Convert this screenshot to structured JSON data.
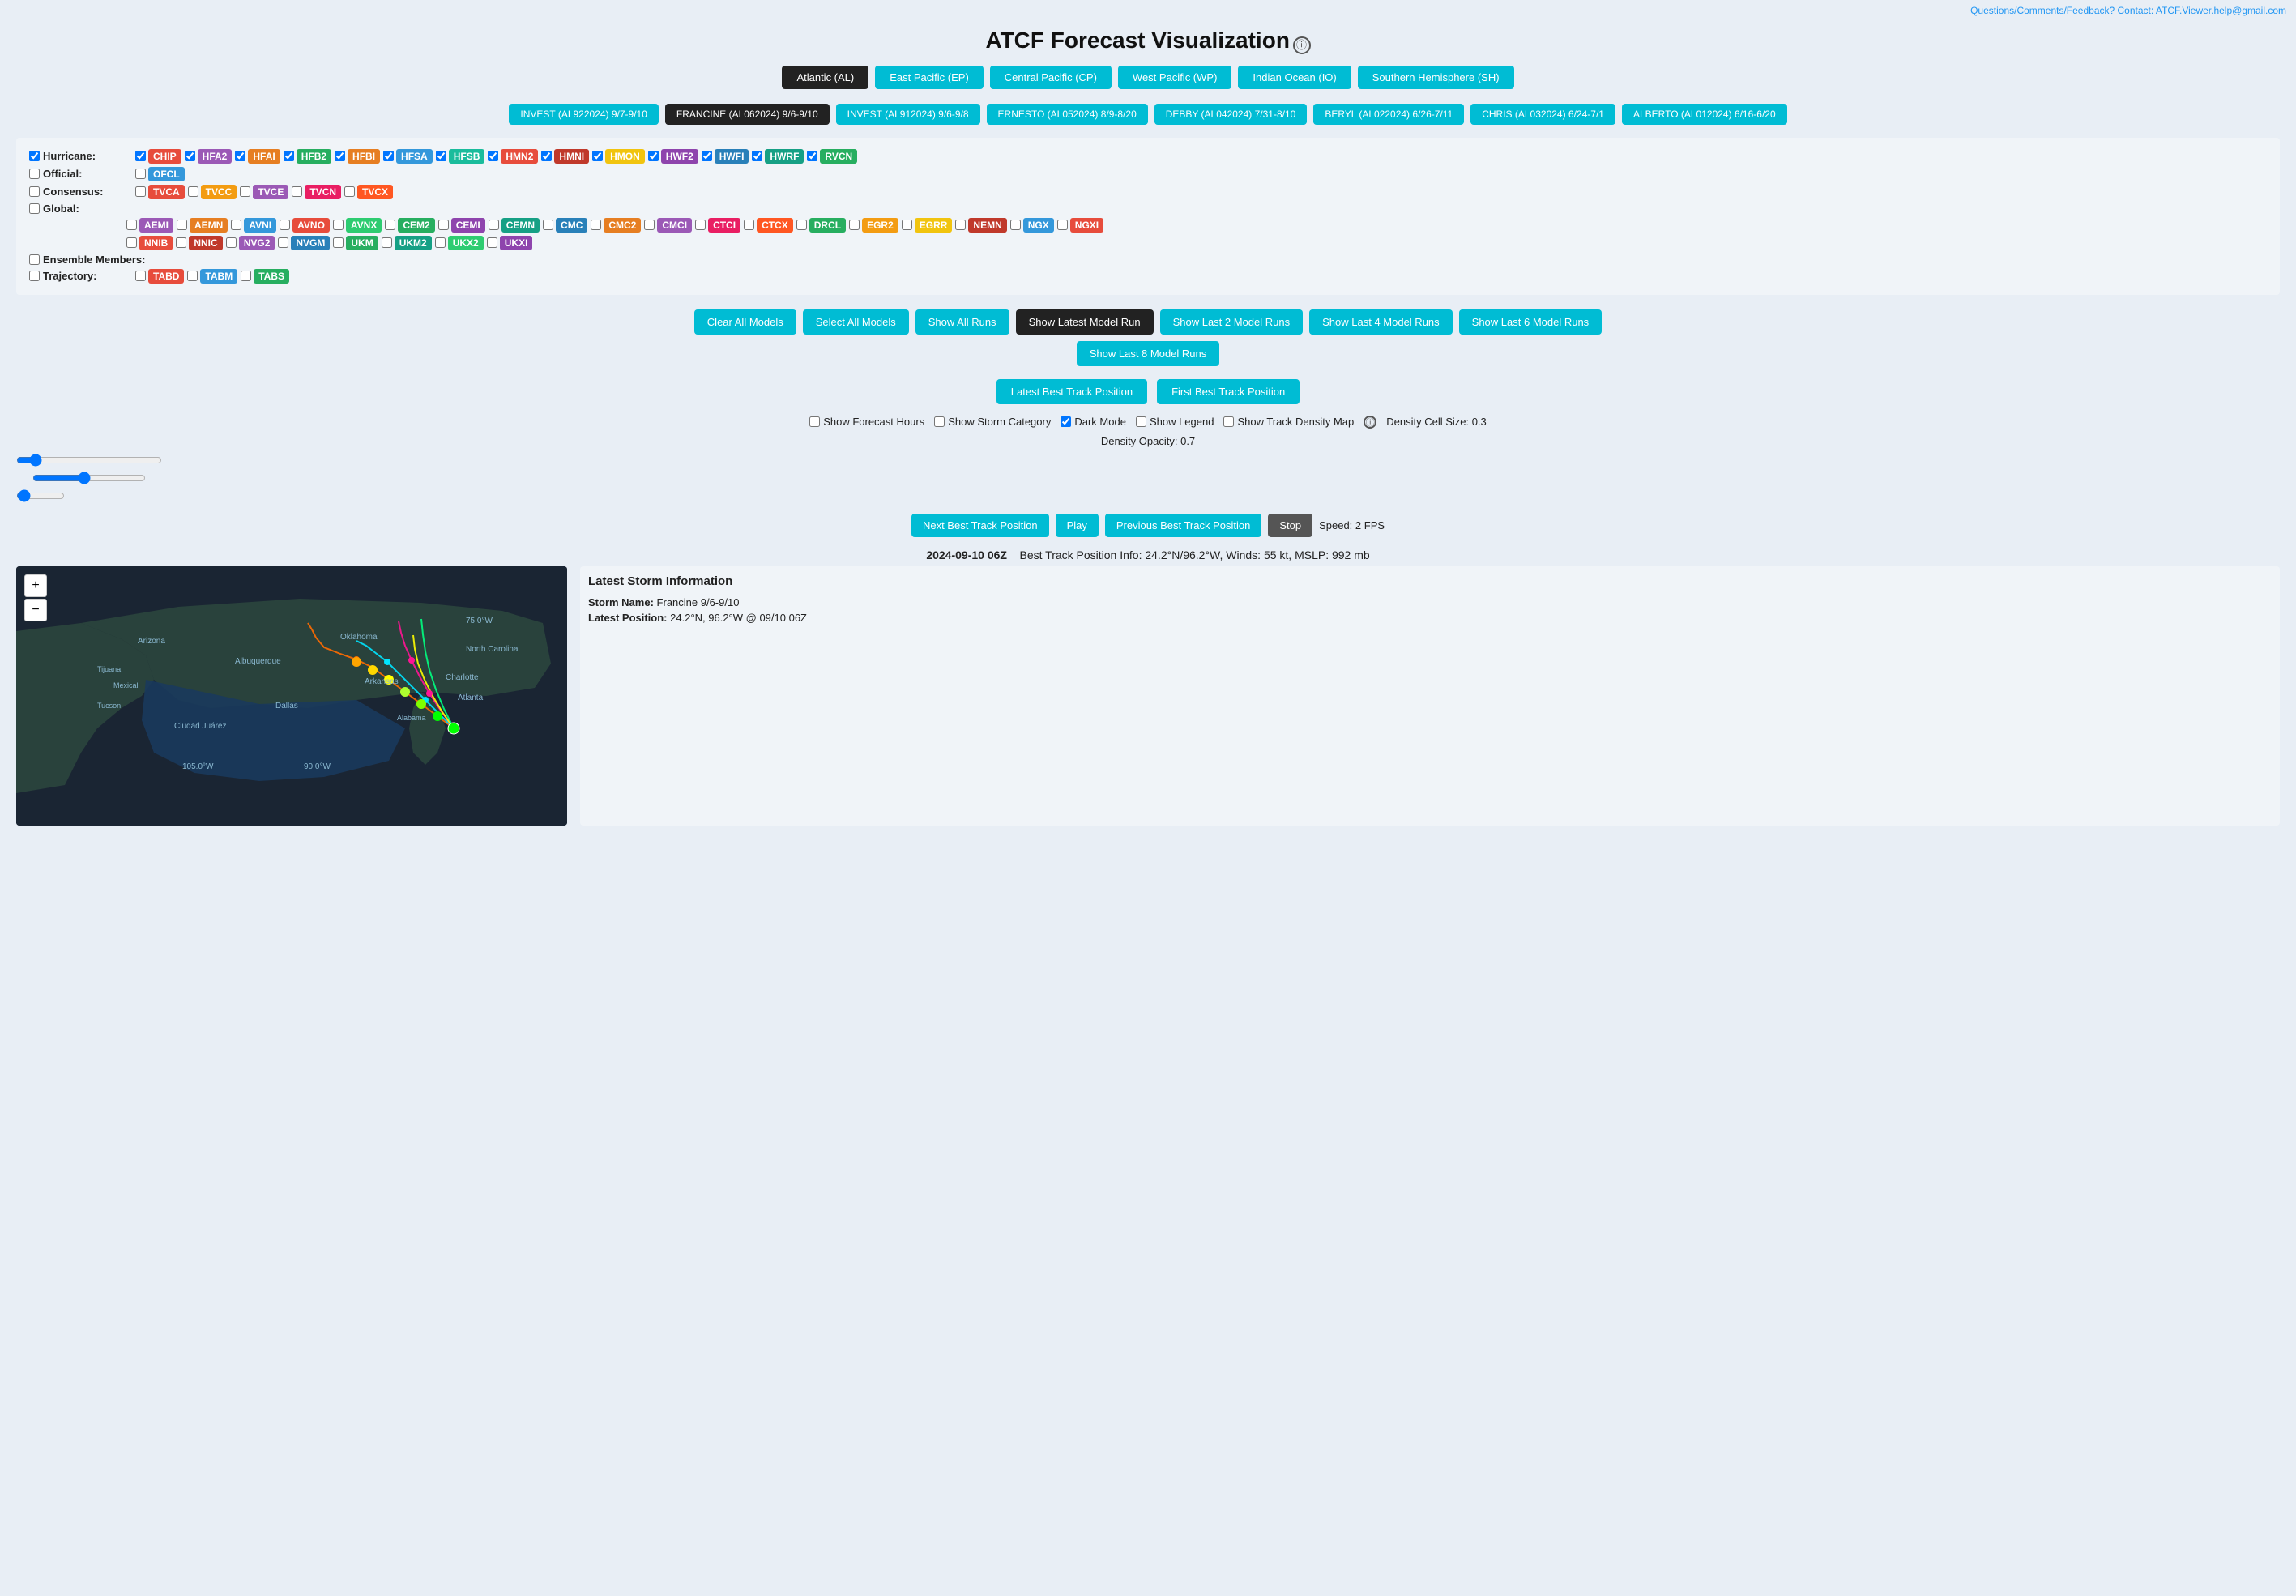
{
  "feedback_link": "Questions/Comments/Feedback? Contact: ATCF.Viewer.help@gmail.com",
  "title": "ATCF Forecast Visualization",
  "info_icon": "ⓘ",
  "basin_tabs": [
    {
      "label": "Atlantic (AL)",
      "active": false
    },
    {
      "label": "East Pacific (EP)",
      "active": false
    },
    {
      "label": "Central Pacific (CP)",
      "active": false
    },
    {
      "label": "West Pacific (WP)",
      "active": false
    },
    {
      "label": "Indian Ocean (IO)",
      "active": false
    },
    {
      "label": "Southern Hemisphere (SH)",
      "active": false
    }
  ],
  "storms": [
    {
      "label": "INVEST (AL922024) 9/7-9/10",
      "active": false
    },
    {
      "label": "FRANCINE (AL062024) 9/6-9/10",
      "active": true
    },
    {
      "label": "INVEST (AL912024) 9/6-9/8",
      "active": false
    },
    {
      "label": "ERNESTO (AL052024) 8/9-8/20",
      "active": false
    },
    {
      "label": "DEBBY (AL042024) 7/31-8/10",
      "active": false
    },
    {
      "label": "BERYL (AL022024) 6/26-7/11",
      "active": false
    },
    {
      "label": "CHRIS (AL032024) 6/24-7/1",
      "active": false
    },
    {
      "label": "ALBERTO (AL012024) 6/16-6/20",
      "active": false
    }
  ],
  "hurricane_models": [
    {
      "label": "CHIP",
      "checked": true,
      "color": "#e74c3c"
    },
    {
      "label": "HFA2",
      "checked": true,
      "color": "#9b59b6"
    },
    {
      "label": "HFAI",
      "checked": true,
      "color": "#e67e22"
    },
    {
      "label": "HFB2",
      "checked": true,
      "color": "#27ae60"
    },
    {
      "label": "HFBI",
      "checked": true,
      "color": "#e67e22"
    },
    {
      "label": "HFSA",
      "checked": true,
      "color": "#3498db"
    },
    {
      "label": "HFSB",
      "checked": true,
      "color": "#1abc9c"
    },
    {
      "label": "HMN2",
      "checked": true,
      "color": "#e74c3c"
    },
    {
      "label": "HMNI",
      "checked": true,
      "color": "#c0392b"
    },
    {
      "label": "HMON",
      "checked": true,
      "color": "#f1c40f"
    },
    {
      "label": "HWF2",
      "checked": true,
      "color": "#8e44ad"
    },
    {
      "label": "HWFI",
      "checked": true,
      "color": "#2980b9"
    },
    {
      "label": "HWRF",
      "checked": true,
      "color": "#16a085"
    },
    {
      "label": "RVCN",
      "checked": true,
      "color": "#27ae60"
    }
  ],
  "official_models": [
    {
      "label": "OFCL",
      "checked": false,
      "color": "#3498db"
    }
  ],
  "consensus_models": [
    {
      "label": "TVCA",
      "checked": false,
      "color": "#e74c3c"
    },
    {
      "label": "TVCC",
      "checked": false,
      "color": "#f39c12"
    },
    {
      "label": "TVCE",
      "checked": false,
      "color": "#9b59b6"
    },
    {
      "label": "TVCN",
      "checked": false,
      "color": "#e91e63"
    },
    {
      "label": "TVCX",
      "checked": false,
      "color": "#ff5722"
    }
  ],
  "global_models_row1": [
    {
      "label": "AEMI",
      "checked": false,
      "color": "#9b59b6"
    },
    {
      "label": "AEMN",
      "checked": false,
      "color": "#e67e22"
    },
    {
      "label": "AVNI",
      "checked": false,
      "color": "#3498db"
    },
    {
      "label": "AVNO",
      "checked": false,
      "color": "#e74c3c"
    },
    {
      "label": "AVNX",
      "checked": false,
      "color": "#2ecc71"
    },
    {
      "label": "CEM2",
      "checked": false,
      "color": "#27ae60"
    },
    {
      "label": "CEMI",
      "checked": false,
      "color": "#8e44ad"
    },
    {
      "label": "CEMN",
      "checked": false,
      "color": "#16a085"
    },
    {
      "label": "CMC",
      "checked": false,
      "color": "#2980b9"
    },
    {
      "label": "CMC2",
      "checked": false,
      "color": "#e67e22"
    },
    {
      "label": "CMCI",
      "checked": false,
      "color": "#9b59b6"
    },
    {
      "label": "CTCI",
      "checked": false,
      "color": "#e91e63"
    },
    {
      "label": "CTCX",
      "checked": false,
      "color": "#ff5722"
    },
    {
      "label": "DRCL",
      "checked": false,
      "color": "#27ae60"
    },
    {
      "label": "EGR2",
      "checked": false,
      "color": "#f39c12"
    },
    {
      "label": "EGRR",
      "checked": false,
      "color": "#f1c40f"
    },
    {
      "label": "NEMN",
      "checked": false,
      "color": "#c0392b"
    },
    {
      "label": "NGX",
      "checked": false,
      "color": "#3498db"
    },
    {
      "label": "NGXI",
      "checked": false,
      "color": "#e74c3c"
    }
  ],
  "global_models_row2": [
    {
      "label": "NNIB",
      "checked": false,
      "color": "#e74c3c"
    },
    {
      "label": "NNIC",
      "checked": false,
      "color": "#c0392b"
    },
    {
      "label": "NVG2",
      "checked": false,
      "color": "#9b59b6"
    },
    {
      "label": "NVGM",
      "checked": false,
      "color": "#2980b9"
    },
    {
      "label": "UKM",
      "checked": false,
      "color": "#27ae60"
    },
    {
      "label": "UKM2",
      "checked": false,
      "color": "#16a085"
    },
    {
      "label": "UKX2",
      "checked": false,
      "color": "#2ecc71"
    },
    {
      "label": "UKXI",
      "checked": false,
      "color": "#8e44ad"
    }
  ],
  "trajectory_models": [
    {
      "label": "TABD",
      "checked": false,
      "color": "#e74c3c"
    },
    {
      "label": "TABM",
      "checked": false,
      "color": "#3498db"
    },
    {
      "label": "TABS",
      "checked": false,
      "color": "#27ae60"
    }
  ],
  "buttons": {
    "clear_all": "Clear All Models",
    "select_all": "Select All Models",
    "show_all_runs": "Show All Runs",
    "show_latest": "Show Latest Model Run",
    "show_last2": "Show Last 2 Model Runs",
    "show_last4": "Show Last 4 Model Runs",
    "show_last6": "Show Last 6 Model Runs",
    "show_last8": "Show Last 8 Model Runs"
  },
  "track_buttons": {
    "latest": "Latest Best Track Position",
    "first": "First Best Track Position",
    "next": "Next Best Track Position",
    "previous": "Previous Best Track Position",
    "play": "Play",
    "stop": "Stop"
  },
  "options": {
    "show_forecast_hours": false,
    "show_storm_category": false,
    "dark_mode": true,
    "show_legend": false,
    "show_track_density": false,
    "density_cell_size": "Density Cell Size: 0.3",
    "density_opacity": "Density Opacity: 0.7"
  },
  "playback": {
    "speed": "Speed: 2 FPS"
  },
  "track_info": {
    "datetime": "2024-09-10 06Z",
    "info": "Best Track Position Info: 24.2°N/96.2°W, Winds: 55 kt, MSLP: 992 mb"
  },
  "storm_info": {
    "title": "Latest Storm Information",
    "name_label": "Storm Name:",
    "name_value": "Francine 9/6-9/10",
    "position_label": "Latest Position:",
    "position_value": "24.2°N, 96.2°W @ 09/10 06Z"
  },
  "map_controls": {
    "zoom_in": "+",
    "zoom_out": "−"
  }
}
